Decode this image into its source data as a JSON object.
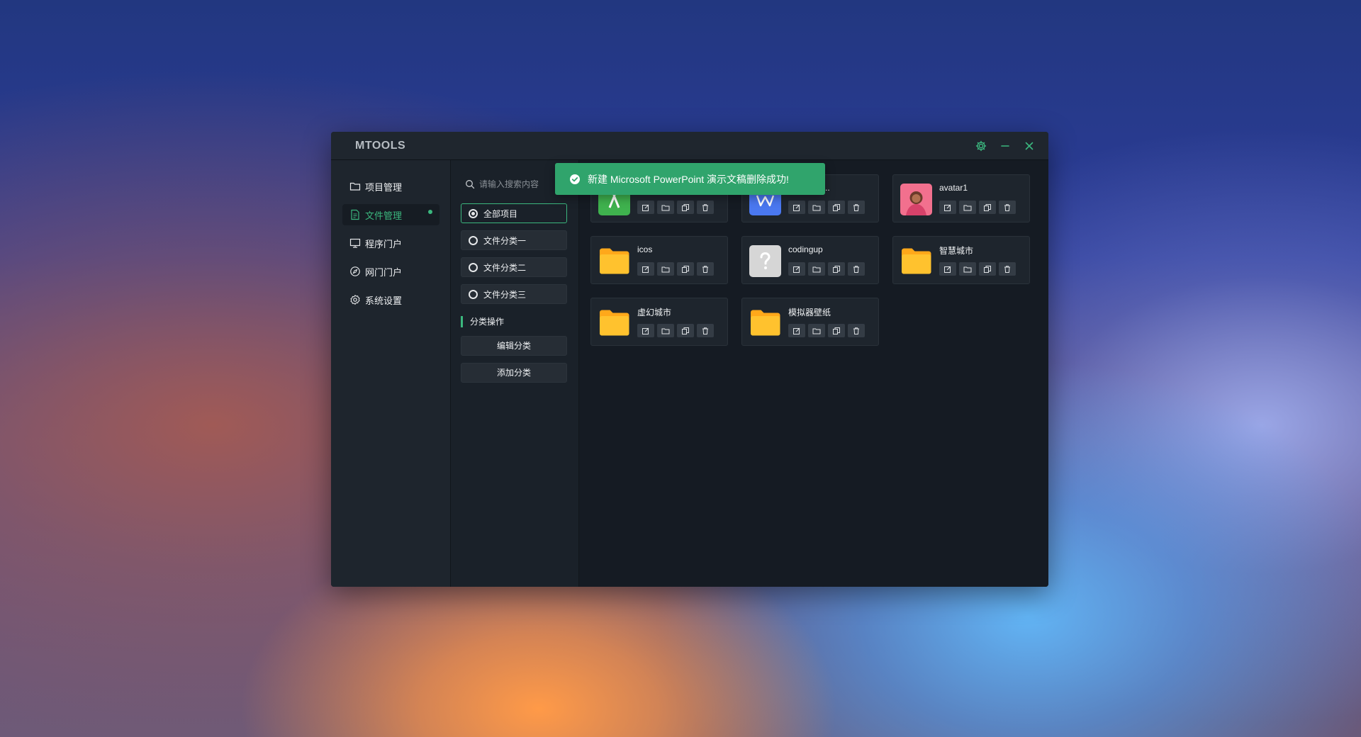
{
  "app": {
    "title": "MTOOLS"
  },
  "colors": {
    "accent": "#3bb77e",
    "toast_bg": "#30a46c",
    "folder": "#ffc22e"
  },
  "titlebar": {
    "icons": [
      "gear-icon",
      "minimize-icon",
      "close-icon"
    ]
  },
  "sidebar": {
    "items": [
      {
        "label": "项目管理",
        "icon": "folder-icon",
        "active": false
      },
      {
        "label": "文件管理",
        "icon": "document-icon",
        "active": true
      },
      {
        "label": "程序门户",
        "icon": "monitor-icon",
        "active": false
      },
      {
        "label": "网门门户",
        "icon": "compass-icon",
        "active": false
      },
      {
        "label": "系统设置",
        "icon": "settings-icon",
        "active": false
      }
    ]
  },
  "categories": {
    "search_placeholder": "请输入搜索内容",
    "items": [
      {
        "label": "全部项目",
        "selected": true
      },
      {
        "label": "文件分类一",
        "selected": false
      },
      {
        "label": "文件分类二",
        "selected": false
      },
      {
        "label": "文件分类三",
        "selected": false
      }
    ],
    "section_title": "分类操作",
    "edit_button": "编辑分类",
    "add_button": "添加分类"
  },
  "files": {
    "cards": [
      {
        "name": "",
        "icon": "android-studio-icon"
      },
      {
        "name": "Microsoft...",
        "icon": "word-icon"
      },
      {
        "name": "avatar1",
        "icon": "avatar-image"
      },
      {
        "name": "icos",
        "icon": "folder-icon"
      },
      {
        "name": "codingup",
        "icon": "unknown-file-icon"
      },
      {
        "name": "智慧城市",
        "icon": "folder-icon"
      },
      {
        "name": "虚幻城市",
        "icon": "folder-icon"
      },
      {
        "name": "模拟器壁纸",
        "icon": "folder-icon"
      }
    ],
    "action_icons": [
      "edit-icon",
      "open-folder-icon",
      "copy-icon",
      "delete-icon"
    ]
  },
  "toast": {
    "message": "新建 Microsoft PowerPoint 演示文稿删除成功!",
    "icon": "check-circle-icon"
  }
}
